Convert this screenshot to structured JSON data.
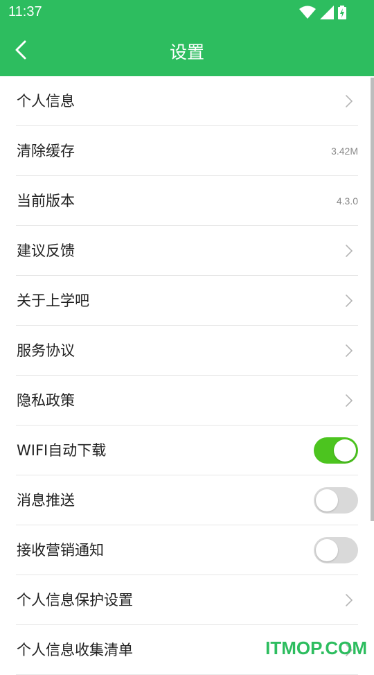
{
  "status_bar": {
    "time": "11:37",
    "icons": [
      "wifi-icon",
      "signal-icon",
      "battery-icon"
    ]
  },
  "header": {
    "title": "设置",
    "back_icon": "back-arrow-icon",
    "background": "#2dbd5f"
  },
  "settings": [
    {
      "label": "个人信息",
      "type": "link"
    },
    {
      "label": "清除缓存",
      "type": "value",
      "value": "3.42M"
    },
    {
      "label": "当前版本",
      "type": "value",
      "value": "4.3.0"
    },
    {
      "label": "建议反馈",
      "type": "link"
    },
    {
      "label": "关于上学吧",
      "type": "link"
    },
    {
      "label": "服务协议",
      "type": "link"
    },
    {
      "label": "隐私政策",
      "type": "link"
    },
    {
      "label": "WIFI自动下载",
      "type": "toggle",
      "on": true
    },
    {
      "label": "消息推送",
      "type": "toggle",
      "on": false
    },
    {
      "label": "接收营销通知",
      "type": "toggle",
      "on": false
    },
    {
      "label": "个人信息保护设置",
      "type": "link"
    },
    {
      "label": "个人信息收集清单",
      "type": "link"
    }
  ],
  "colors": {
    "accent": "#2dbd5f",
    "toggle_on": "#4cc41f",
    "toggle_off": "#d9d9d9"
  },
  "watermark": "ITMOP.COM"
}
